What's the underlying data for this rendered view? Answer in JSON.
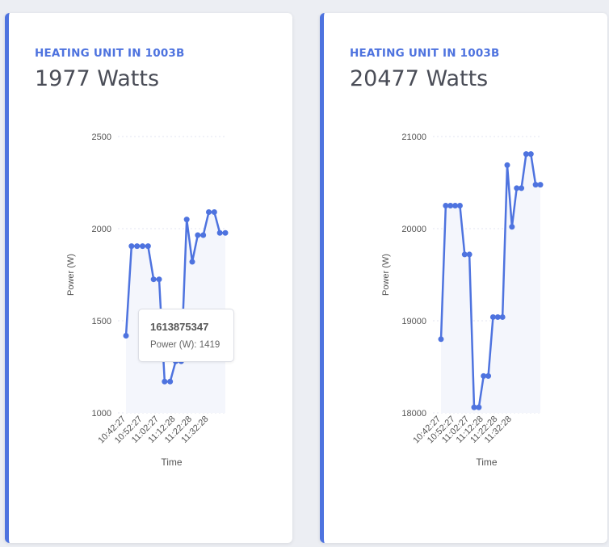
{
  "cards": [
    {
      "label": "HEATING UNIT IN 1003B",
      "value": "1977 Watts"
    },
    {
      "label": "HEATING UNIT IN 1003B",
      "value": "20477 Watts"
    }
  ],
  "tooltip": {
    "title": "1613875347",
    "series_label": "Power (W): 1419"
  },
  "colors": {
    "accent": "#4e73df",
    "line": "#4e73df",
    "area_fill": "#f4f6fc",
    "gridline": "#e3e6f0",
    "tick_text": "#555555"
  },
  "chart_data": [
    {
      "type": "line",
      "xlabel": "Time",
      "ylabel": "Power (W)",
      "x_tick_labels": [
        "10:42:27",
        "10:52:27",
        "11:02:27",
        "11:12:28",
        "11:22:28",
        "11:32:28"
      ],
      "y_ticks": [
        1000,
        1500,
        2000,
        2500
      ],
      "ylim": [
        1000,
        2500
      ],
      "grid": true,
      "fill": true,
      "points_per_tick": 3,
      "series": [
        {
          "values": [
            1419,
            1905,
            1905,
            1905,
            1905,
            1725,
            1725,
            1170,
            1170,
            1280,
            1280,
            2050,
            1820,
            1965,
            1965,
            2090,
            2090,
            1977,
            1977
          ]
        }
      ]
    },
    {
      "type": "line",
      "xlabel": "Time",
      "ylabel": "Power (W)",
      "x_tick_labels": [
        "10:42:27",
        "10:52:27",
        "11:02:27",
        "11:12:28",
        "11:22:28",
        "11:32:28"
      ],
      "y_ticks": [
        18000,
        19000,
        20000,
        21000
      ],
      "ylim": [
        18000,
        21000
      ],
      "grid": true,
      "fill": true,
      "points_per_tick": 3,
      "series": [
        {
          "values": [
            18800,
            20250,
            20250,
            20250,
            20250,
            19720,
            19720,
            18060,
            18060,
            18400,
            18400,
            19040,
            19040,
            19040,
            20690,
            20020,
            20440,
            20440,
            20810,
            20810,
            20477,
            20477
          ]
        }
      ]
    }
  ]
}
